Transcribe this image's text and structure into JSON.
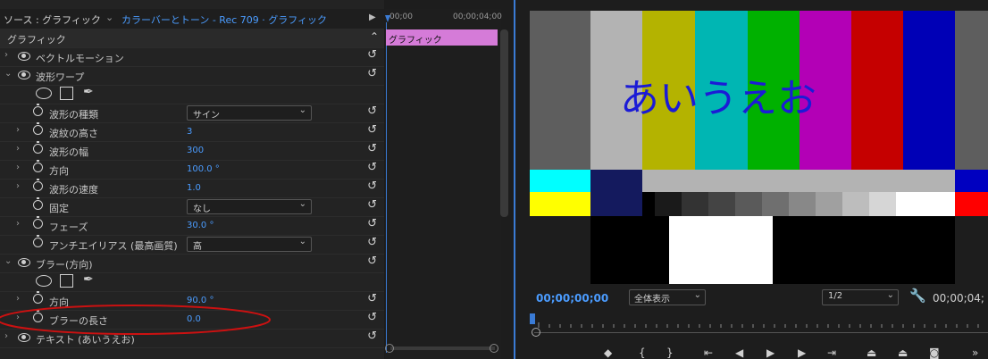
{
  "effect_controls": {
    "source_label": "ソース : グラフィック",
    "clip_label": "カラーバーとトーン - Rec 709 · グラフィック",
    "rows": [
      {
        "label": "グラフィック"
      },
      {
        "label": "ベクトルモーション"
      },
      {
        "label": "波形ワープ"
      },
      {
        "label": "波形の種類",
        "value": "サイン"
      },
      {
        "label": "波紋の高さ",
        "value": "3"
      },
      {
        "label": "波形の幅",
        "value": "300"
      },
      {
        "label": "方向",
        "value": "100.0 °"
      },
      {
        "label": "波形の速度",
        "value": "1.0"
      },
      {
        "label": "固定",
        "value": "なし"
      },
      {
        "label": "フェーズ",
        "value": "30.0 °"
      },
      {
        "label": "アンチエイリアス (最高画質)",
        "value": "高"
      },
      {
        "label": "ブラー(方向)"
      },
      {
        "label": "方向",
        "value": "90.0 °"
      },
      {
        "label": "ブラーの長さ",
        "value": "0.0"
      },
      {
        "label": "テキスト (あいうえお)"
      }
    ]
  },
  "timeline": {
    "time_start": "00;00",
    "time_end": "00;00;04;00",
    "clip_label": "グラフィック"
  },
  "monitor": {
    "overlay_text": "あいうえお",
    "timecode": "00;00;00;00",
    "zoom_select": "全体表示",
    "resolution_select": "1/2",
    "duration": "00;00;04;"
  },
  "colors": {
    "accent": "#4b9cff",
    "clip": "#d57bd8",
    "annotation": "#cc1111"
  }
}
